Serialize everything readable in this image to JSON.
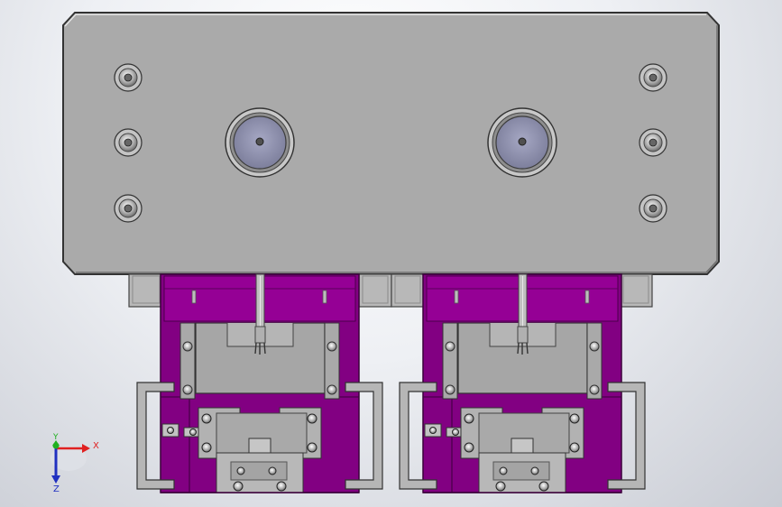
{
  "viewport": {
    "background_top": "#ffffff",
    "background_bottom": "#c9ccd4"
  },
  "colors": {
    "plate_fill": "#a9a9a9",
    "plate_edge": "#3a3a3a",
    "purple_body": "#800080",
    "purple_dark": "#5c005c",
    "steel": "#b4b4b4",
    "steel_dark": "#808080",
    "bushing_face": "#9a9cb8",
    "axis_x": "#e02020",
    "axis_y": "#20b020",
    "axis_z": "#2030c0"
  },
  "model": {
    "top_plate": {
      "name": "upper-die-plate"
    },
    "guide_bushings": 2,
    "mounting_screws": 6,
    "modules": [
      {
        "name": "module-left"
      },
      {
        "name": "module-right"
      }
    ]
  },
  "triad": {
    "x_label": "X",
    "y_label": "Y",
    "z_label": "Z",
    "icon": "axis-triad-icon"
  }
}
